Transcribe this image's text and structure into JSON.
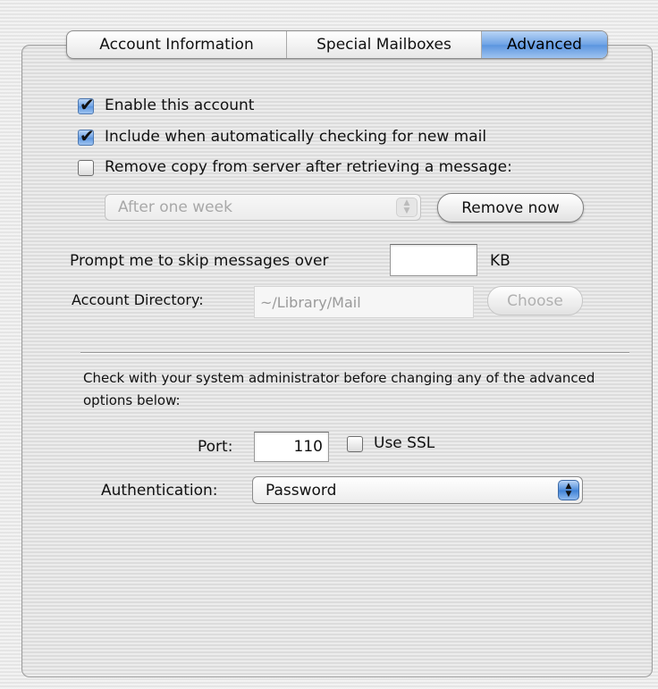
{
  "tabs": [
    {
      "label": "Account Information",
      "selected": false
    },
    {
      "label": "Special Mailboxes",
      "selected": false
    },
    {
      "label": "Advanced",
      "selected": true
    }
  ],
  "options": {
    "enable_account": {
      "label": "Enable this account",
      "checked": true
    },
    "include_auto_check": {
      "label": "Include when automatically checking for new mail",
      "checked": true
    },
    "remove_copy": {
      "label": "Remove copy from server after retrieving a message:",
      "checked": false
    }
  },
  "remove_after": {
    "selected": "After one week",
    "enabled": false
  },
  "remove_now_button": "Remove now",
  "prompt_skip": {
    "label": "Prompt me to skip messages over",
    "value": "",
    "unit": "KB"
  },
  "account_directory": {
    "label": "Account Directory:",
    "value": "~/Library/Mail",
    "choose_label": "Choose"
  },
  "advanced_note": "Check with your system administrator before changing any of the advanced options below:",
  "port": {
    "label": "Port:",
    "value": "110"
  },
  "use_ssl": {
    "label": "Use SSL",
    "checked": false
  },
  "authentication": {
    "label": "Authentication:",
    "selected": "Password"
  },
  "colors": {
    "accent": "#6fa3e6",
    "panel": "#e4e4e4"
  }
}
